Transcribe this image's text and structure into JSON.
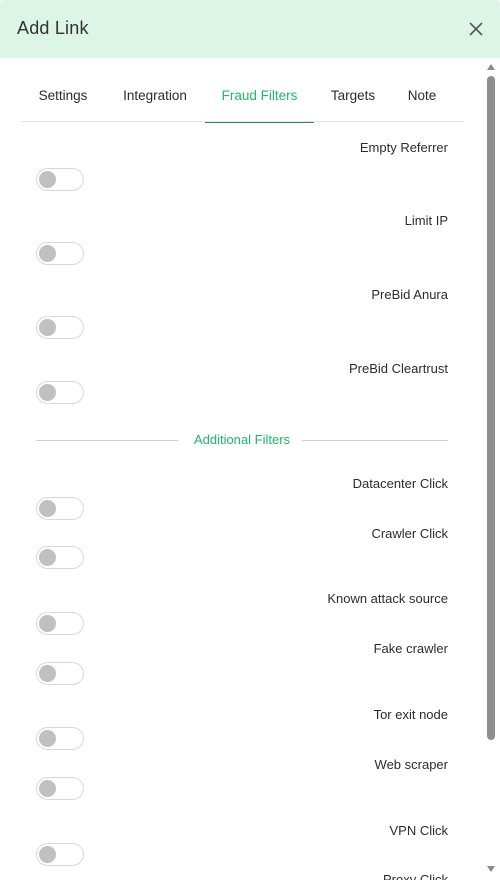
{
  "modal": {
    "title": "Add Link",
    "close_icon": "close-icon"
  },
  "tabs": [
    {
      "label": "Settings",
      "active": false
    },
    {
      "label": "Integration",
      "active": false
    },
    {
      "label": "Fraud Filters",
      "active": true
    },
    {
      "label": "Targets",
      "active": false
    },
    {
      "label": "Note",
      "active": false
    }
  ],
  "filters": [
    {
      "label": "Empty Referrer",
      "enabled": false
    },
    {
      "label": "Limit IP",
      "enabled": false
    },
    {
      "label": "PreBid Anura",
      "enabled": false
    },
    {
      "label": "PreBid Cleartrust",
      "enabled": false
    }
  ],
  "additional_filters": {
    "heading": "Additional Filters",
    "items": [
      {
        "label": "Datacenter Click",
        "enabled": false
      },
      {
        "label": "Crawler Click",
        "enabled": false
      },
      {
        "label": "Known attack source",
        "enabled": false
      },
      {
        "label": "Fake crawler",
        "enabled": false
      },
      {
        "label": "Tor exit node",
        "enabled": false
      },
      {
        "label": "Web scraper",
        "enabled": false
      },
      {
        "label": "VPN Click",
        "enabled": false
      },
      {
        "label": "Proxy Click",
        "enabled": false
      }
    ]
  },
  "colors": {
    "header_bg": "#dcf5e7",
    "accent_green": "#1fb768",
    "tab_underline": "#3b74ad",
    "toggle_knob": "#bfbfc4"
  }
}
